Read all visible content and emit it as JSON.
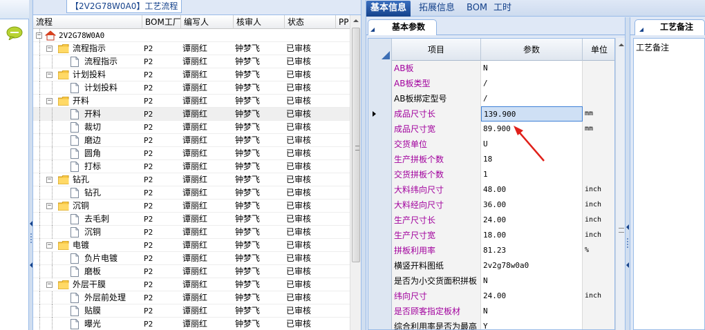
{
  "colors": {
    "accent": "#15428b",
    "highlight_text": "#a1009d",
    "arrow": "#e0201a",
    "selected_cell": "#cfe0f5"
  },
  "left_panel": {
    "icon": "chat-bubble-icon"
  },
  "tree_panel": {
    "tab_label": "【2V2G78W0A0】工艺流程",
    "columns": [
      "流程",
      "BOM工厂",
      "编写人",
      "核审人",
      "状态",
      "PP"
    ],
    "rows": [
      {
        "name": "2V2G78W0A0",
        "type": "root",
        "depth": 0,
        "factory": "",
        "writer": "",
        "checker": "",
        "status": ""
      },
      {
        "name": "流程指示",
        "type": "folder",
        "depth": 1,
        "factory": "P2",
        "writer": "谭丽红",
        "checker": "钟梦飞",
        "status": "已审核"
      },
      {
        "name": "流程指示",
        "type": "leaf",
        "depth": 2,
        "factory": "P2",
        "writer": "谭丽红",
        "checker": "钟梦飞",
        "status": "已审核"
      },
      {
        "name": "计划投料",
        "type": "folder",
        "depth": 1,
        "factory": "P2",
        "writer": "谭丽红",
        "checker": "钟梦飞",
        "status": "已审核"
      },
      {
        "name": "计划投料",
        "type": "leaf",
        "depth": 2,
        "factory": "P2",
        "writer": "谭丽红",
        "checker": "钟梦飞",
        "status": "已审核"
      },
      {
        "name": "开料",
        "type": "folder",
        "depth": 1,
        "factory": "P2",
        "writer": "谭丽红",
        "checker": "钟梦飞",
        "status": "已审核"
      },
      {
        "name": "开料",
        "type": "leaf",
        "depth": 2,
        "factory": "P2",
        "writer": "谭丽红",
        "checker": "钟梦飞",
        "status": "已审核",
        "selected": true
      },
      {
        "name": "裁切",
        "type": "leaf",
        "depth": 2,
        "factory": "P2",
        "writer": "谭丽红",
        "checker": "钟梦飞",
        "status": "已审核"
      },
      {
        "name": "磨边",
        "type": "leaf",
        "depth": 2,
        "factory": "P2",
        "writer": "谭丽红",
        "checker": "钟梦飞",
        "status": "已审核"
      },
      {
        "name": "圆角",
        "type": "leaf",
        "depth": 2,
        "factory": "P2",
        "writer": "谭丽红",
        "checker": "钟梦飞",
        "status": "已审核"
      },
      {
        "name": "打标",
        "type": "leaf",
        "depth": 2,
        "factory": "P2",
        "writer": "谭丽红",
        "checker": "钟梦飞",
        "status": "已审核"
      },
      {
        "name": "钻孔",
        "type": "folder",
        "depth": 1,
        "factory": "P2",
        "writer": "谭丽红",
        "checker": "钟梦飞",
        "status": "已审核"
      },
      {
        "name": "钻孔",
        "type": "leaf",
        "depth": 2,
        "factory": "P2",
        "writer": "谭丽红",
        "checker": "钟梦飞",
        "status": "已审核"
      },
      {
        "name": "沉铜",
        "type": "folder",
        "depth": 1,
        "factory": "P2",
        "writer": "谭丽红",
        "checker": "钟梦飞",
        "status": "已审核"
      },
      {
        "name": "去毛刺",
        "type": "leaf",
        "depth": 2,
        "factory": "P2",
        "writer": "谭丽红",
        "checker": "钟梦飞",
        "status": "已审核"
      },
      {
        "name": "沉铜",
        "type": "leaf",
        "depth": 2,
        "factory": "P2",
        "writer": "谭丽红",
        "checker": "钟梦飞",
        "status": "已审核"
      },
      {
        "name": "电镀",
        "type": "folder",
        "depth": 1,
        "factory": "P2",
        "writer": "谭丽红",
        "checker": "钟梦飞",
        "status": "已审核"
      },
      {
        "name": "负片电镀",
        "type": "leaf",
        "depth": 2,
        "factory": "P2",
        "writer": "谭丽红",
        "checker": "钟梦飞",
        "status": "已审核"
      },
      {
        "name": "磨板",
        "type": "leaf",
        "depth": 2,
        "factory": "P2",
        "writer": "谭丽红",
        "checker": "钟梦飞",
        "status": "已审核"
      },
      {
        "name": "外层干膜",
        "type": "folder",
        "depth": 1,
        "factory": "P2",
        "writer": "谭丽红",
        "checker": "钟梦飞",
        "status": "已审核"
      },
      {
        "name": "外层前处理",
        "type": "leaf",
        "depth": 2,
        "factory": "P2",
        "writer": "谭丽红",
        "checker": "钟梦飞",
        "status": "已审核"
      },
      {
        "name": "贴膜",
        "type": "leaf",
        "depth": 2,
        "factory": "P2",
        "writer": "谭丽红",
        "checker": "钟梦飞",
        "status": "已审核"
      },
      {
        "name": "曝光",
        "type": "leaf",
        "depth": 2,
        "factory": "P2",
        "writer": "谭丽红",
        "checker": "钟梦飞",
        "status": "已审核"
      }
    ]
  },
  "main_tabs": [
    {
      "label": "基本信息",
      "active": true
    },
    {
      "label": "拓展信息",
      "active": false
    },
    {
      "label": "BOM",
      "active": false
    },
    {
      "label": "工时",
      "active": false
    }
  ],
  "sub_tab": {
    "label": "基本参数"
  },
  "property_grid": {
    "headers": {
      "item": "项目",
      "param": "参数",
      "unit": "单位"
    },
    "rows": [
      {
        "item": "AB板",
        "value": "N",
        "unit": "",
        "highlight": true
      },
      {
        "item": "AB板类型",
        "value": "/",
        "unit": "",
        "highlight": true
      },
      {
        "item": "AB板绑定型号",
        "value": "/",
        "unit": "",
        "highlight": false
      },
      {
        "item": "成品尺寸长",
        "value": "139.900",
        "unit": "mm",
        "highlight": true,
        "current": true
      },
      {
        "item": "成品尺寸宽",
        "value": "89.900",
        "unit": "mm",
        "highlight": true
      },
      {
        "item": "交货单位",
        "value": "U",
        "unit": "",
        "highlight": true
      },
      {
        "item": "生产拼板个数",
        "value": "18",
        "unit": "",
        "highlight": true
      },
      {
        "item": "交货拼板个数",
        "value": "1",
        "unit": "",
        "highlight": true
      },
      {
        "item": "大料纬向尺寸",
        "value": "48.00",
        "unit": "inch",
        "highlight": true
      },
      {
        "item": "大料经向尺寸",
        "value": "36.00",
        "unit": "inch",
        "highlight": true
      },
      {
        "item": "生产尺寸长",
        "value": "24.00",
        "unit": "inch",
        "highlight": true
      },
      {
        "item": "生产尺寸宽",
        "value": "18.00",
        "unit": "inch",
        "highlight": true
      },
      {
        "item": "拼板利用率",
        "value": "81.23",
        "unit": "%",
        "highlight": true
      },
      {
        "item": "横竖开料图纸",
        "value": "2v2g78w0a0",
        "unit": "",
        "highlight": false
      },
      {
        "item": "是否为小交货面积拼板",
        "value": "N",
        "unit": "",
        "highlight": false
      },
      {
        "item": "纬向尺寸",
        "value": "24.00",
        "unit": "inch",
        "highlight": true
      },
      {
        "item": "是否顾客指定板材",
        "value": "N",
        "unit": "",
        "highlight": true
      },
      {
        "item": "综合利用率是否为最高",
        "value": "Y",
        "unit": "",
        "highlight": false
      }
    ]
  },
  "notes_panel": {
    "tab_label": "工艺备注",
    "field_label": "工艺备注"
  }
}
